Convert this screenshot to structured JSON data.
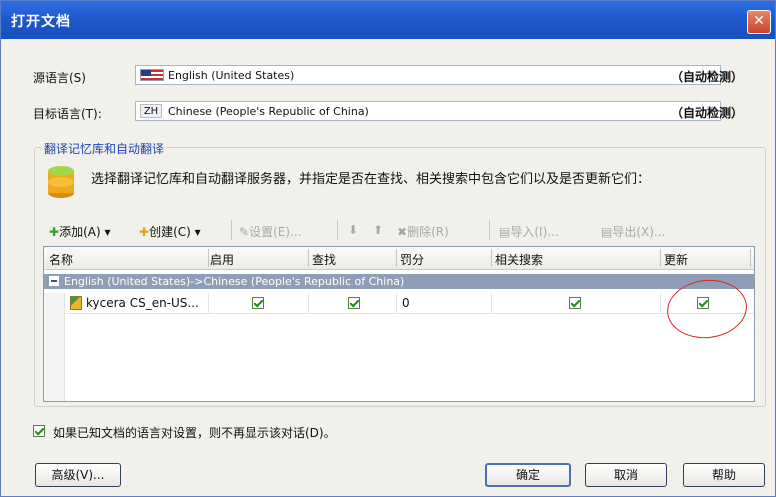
{
  "dialog": {
    "title": "打开文档",
    "close_glyph": "✕"
  },
  "source": {
    "label": "源语言(S)",
    "value": "English (United States)",
    "auto": "（自动检测）",
    "flag_icon": "us-flag-icon"
  },
  "target": {
    "label": "目标语言(T):",
    "code": "ZH",
    "value": "Chinese (People's Republic of China)",
    "auto": "（自动检测）"
  },
  "group": {
    "title": "翻译记忆库和自动翻译",
    "description": "选择翻译记忆库和自动翻译服务器，并指定是否在查找、相关搜索中包含它们以及是否更新它们："
  },
  "toolbar": {
    "add": "添加(A) ▾",
    "create": "创建(C) ▾",
    "settings": "设置(E)...",
    "delete": "删除(R)",
    "import": "导入(I)...",
    "export": "导出(X)..."
  },
  "grid": {
    "columns": [
      "名称",
      "启用",
      "查找",
      "罚分",
      "相关搜索",
      "更新"
    ],
    "group_row": "English (United States)->Chinese (People's Republic of China)",
    "rows": [
      {
        "name": "kycera CS_en-US...",
        "enabled": true,
        "lookup": true,
        "penalty": "0",
        "concordance": true,
        "update": true
      }
    ]
  },
  "options": {
    "no_show_label": "如果已知文档的语言对设置，则不再显示该对话(D)。",
    "no_show_checked": true
  },
  "buttons": {
    "advanced": "高级(V)...",
    "ok": "确定",
    "cancel": "取消",
    "help": "帮助"
  },
  "colors": {
    "titlebar": "#1c56c9",
    "accent": "#1b44b8",
    "annotation": "#d72a2a"
  }
}
